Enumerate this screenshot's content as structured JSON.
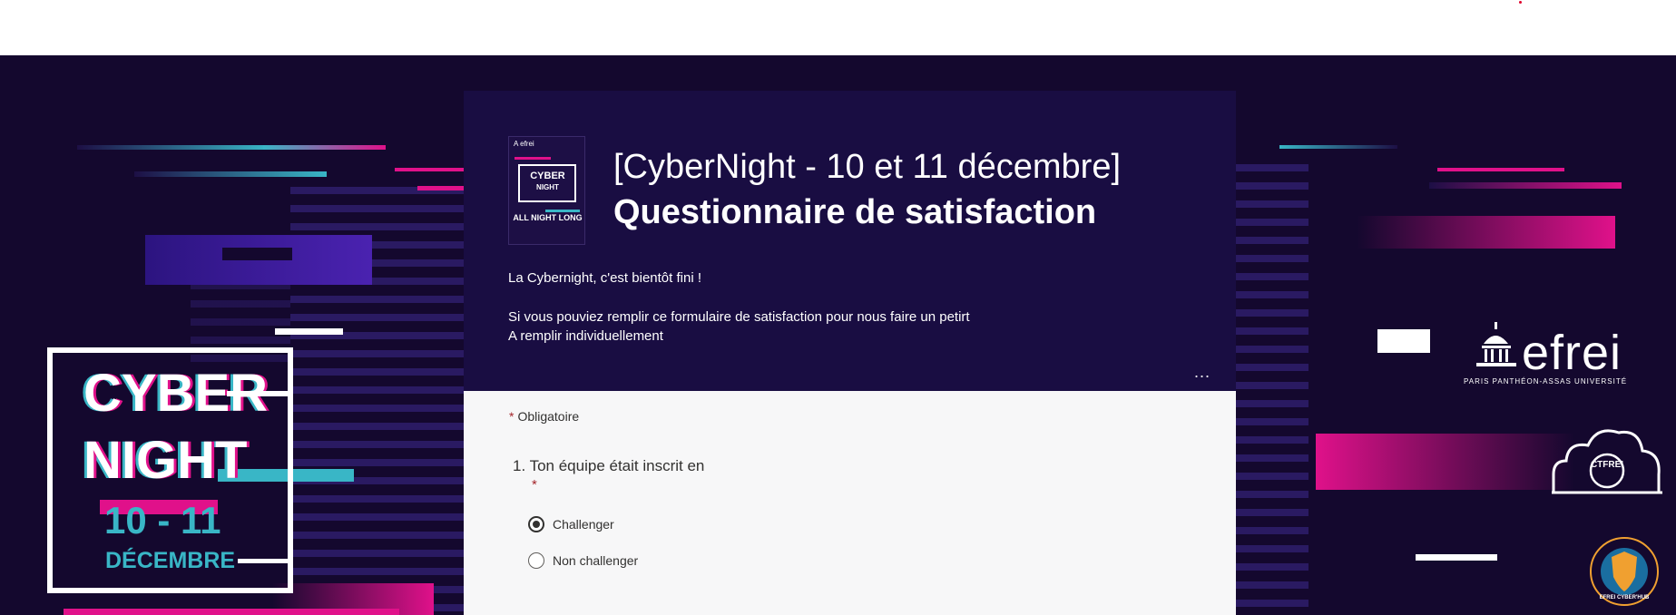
{
  "form": {
    "title_line1": "[CyberNight - 10 et 11 décembre]",
    "title_line2": "Questionnaire de satisfaction",
    "description_line1": "La Cybernight, c'est bientôt fini !",
    "description_line2": "Si vous pouviez remplir ce formulaire de satisfaction pour nous faire un petirt",
    "description_line3": "A remplir individuellement",
    "more_options": "...",
    "required_star": "*",
    "required_label": "Obligatoire",
    "question1": {
      "label": "1. Ton équipe était inscrit en",
      "required_star": "*",
      "options": [
        {
          "label": "Challenger",
          "selected": true
        },
        {
          "label": "Non challenger",
          "selected": false
        }
      ]
    }
  },
  "thumbnail": {
    "logo": "A efrei",
    "cyber": "CYBER",
    "night": "NIGHT",
    "all_night": "ALL NIGHT LONG"
  },
  "banner_left": {
    "cyber": "CYBER",
    "night": "NIGHT",
    "dates": "10 - 11",
    "month": "DÉCEMBRE"
  },
  "banner_right": {
    "efrei_logo": "efrei",
    "efrei_subtitle": "PARIS PANTHÉON-ASSAS UNIVERSITÉ",
    "ctfrei_logo": "CTFREI",
    "cyberhub_logo": "EFREI CYBER'HUB"
  },
  "colors": {
    "background": "#14082e",
    "header_card": "#190d42",
    "accent_pink": "#e0118a",
    "accent_cyan": "#39b6c6",
    "required_red": "#a4262c"
  }
}
